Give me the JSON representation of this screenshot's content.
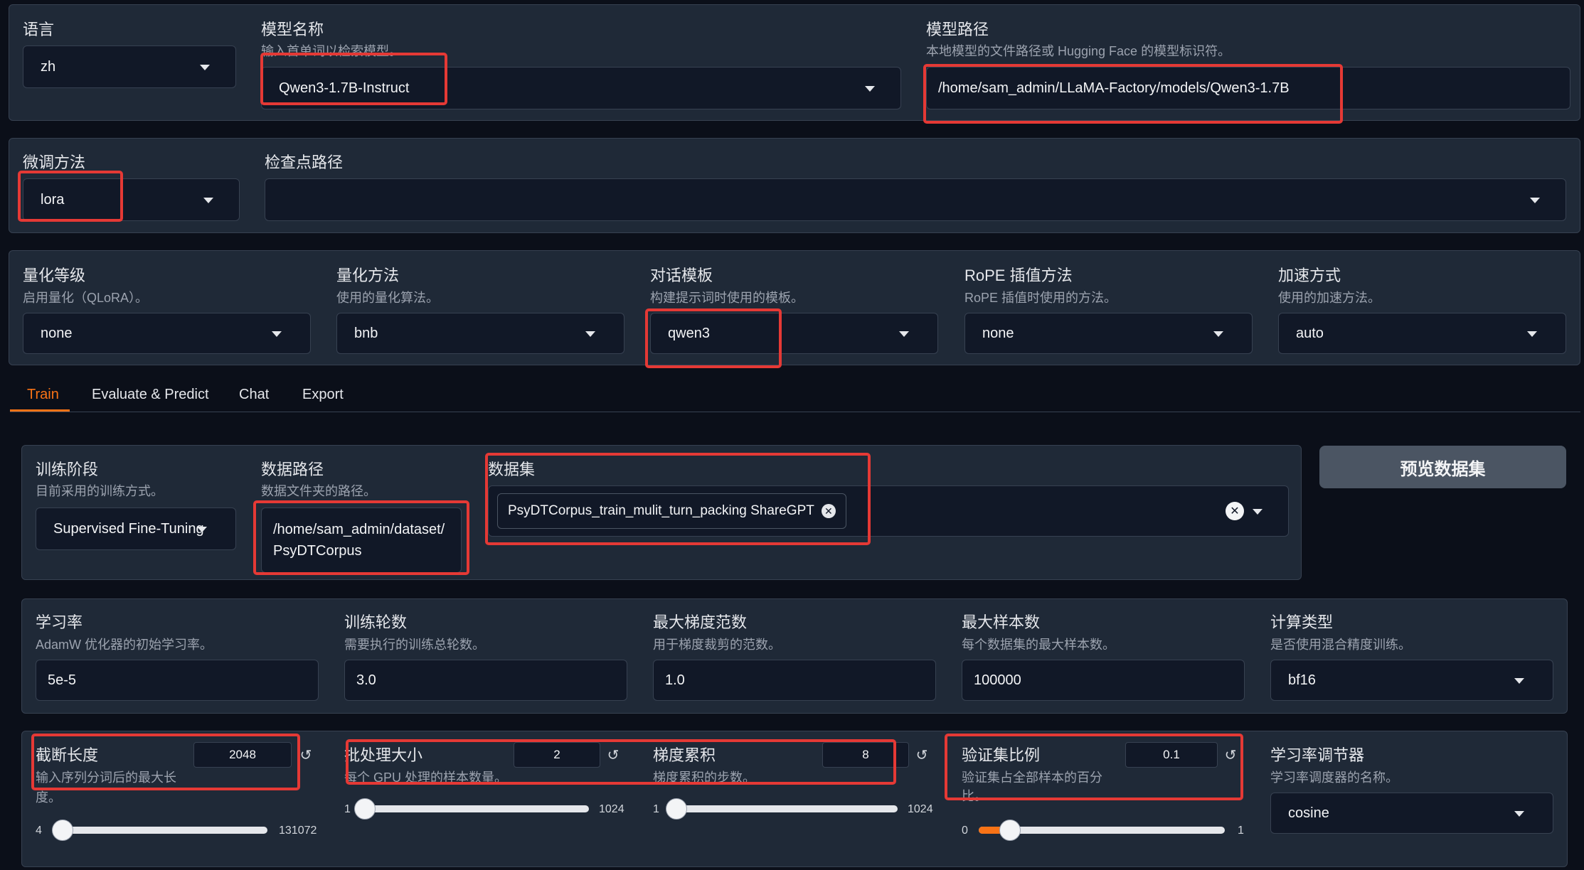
{
  "top": {
    "lang": {
      "label": "语言",
      "value": "zh"
    },
    "model_name": {
      "label": "模型名称",
      "info": "输入首单词以检索模型。",
      "value": "Qwen3-1.7B-Instruct"
    },
    "model_path": {
      "label": "模型路径",
      "info": "本地模型的文件路径或 Hugging Face 的模型标识符。",
      "value": "/home/sam_admin/LLaMA-Factory/models/Qwen3-1.7B"
    }
  },
  "finetune": {
    "method": {
      "label": "微调方法",
      "value": "lora"
    },
    "checkpoint": {
      "label": "检查点路径",
      "value": ""
    }
  },
  "advanced": {
    "quant_bit": {
      "label": "量化等级",
      "info": "启用量化（QLoRA）。",
      "value": "none"
    },
    "quant_method": {
      "label": "量化方法",
      "info": "使用的量化算法。",
      "value": "bnb"
    },
    "template": {
      "label": "对话模板",
      "info": "构建提示词时使用的模板。",
      "value": "qwen3"
    },
    "rope": {
      "label": "RoPE 插值方法",
      "info": "RoPE 插值时使用的方法。",
      "value": "none"
    },
    "booster": {
      "label": "加速方式",
      "info": "使用的加速方法。",
      "value": "auto"
    }
  },
  "tabs": [
    "Train",
    "Evaluate & Predict",
    "Chat",
    "Export"
  ],
  "active_tab": "Train",
  "train": {
    "stage": {
      "label": "训练阶段",
      "info": "目前采用的训练方式。",
      "value": "Supervised Fine-Tuning"
    },
    "dataset_dir": {
      "label": "数据路径",
      "info": "数据文件夹的路径。",
      "value_line1": "/home/sam_admin/dataset/",
      "value_line2": "PsyDTCorpus"
    },
    "dataset": {
      "label": "数据集",
      "chip": "PsyDTCorpus_train_mulit_turn_packing ShareGPT"
    },
    "preview_button": "预览数据集",
    "learning_rate": {
      "label": "学习率",
      "info": "AdamW 优化器的初始学习率。",
      "value": "5e-5"
    },
    "epochs": {
      "label": "训练轮数",
      "info": "需要执行的训练总轮数。",
      "value": "3.0"
    },
    "max_grad_norm": {
      "label": "最大梯度范数",
      "info": "用于梯度裁剪的范数。",
      "value": "1.0"
    },
    "max_samples": {
      "label": "最大样本数",
      "info": "每个数据集的最大样本数。",
      "value": "100000"
    },
    "compute_type": {
      "label": "计算类型",
      "info": "是否使用混合精度训练。",
      "value": "bf16"
    },
    "cutoff_len": {
      "label": "截断长度",
      "info_line1": "输入序列分词后的最大长",
      "info_line2": "度。",
      "value": "2048",
      "min": "4",
      "max": "131072",
      "fraction": 0.015
    },
    "batch_size": {
      "label": "批处理大小",
      "info": "每个 GPU 处理的样本数量。",
      "value": "2",
      "min": "1",
      "max": "1024",
      "fraction": 0.001
    },
    "grad_accum": {
      "label": "梯度累积",
      "info": "梯度累积的步数。",
      "value": "8",
      "min": "1",
      "max": "1024",
      "fraction": 0.007
    },
    "val_size": {
      "label": "验证集比例",
      "info_line1": "验证集占全部样本的百分",
      "info_line2": "比。",
      "value": "0.1",
      "min": "0",
      "max": "1",
      "fraction": 0.1
    },
    "lr_scheduler": {
      "label": "学习率调节器",
      "info": "学习率调度器的名称。",
      "value": "cosine"
    }
  },
  "colors": {
    "accent": "#f97316",
    "highlight": "#e53935",
    "background": "#0b0f19",
    "panel": "#1f2937"
  },
  "icons": [
    "chevron-down-icon",
    "reset-icon",
    "clear-icon",
    "chip-remove-icon"
  ]
}
